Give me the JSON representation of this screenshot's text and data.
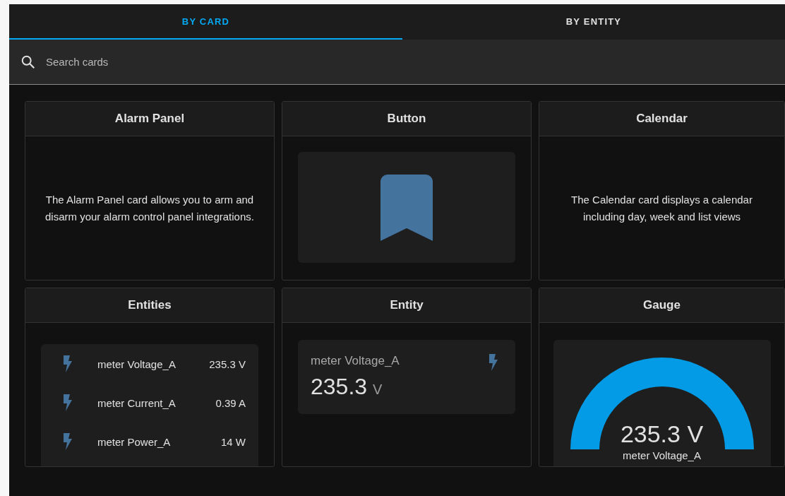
{
  "tabs": [
    {
      "label": "BY CARD",
      "selected": true
    },
    {
      "label": "BY ENTITY",
      "selected": false
    }
  ],
  "search": {
    "placeholder": "Search cards"
  },
  "cards": [
    {
      "title": "Alarm Panel",
      "kind": "text",
      "description": "The Alarm Panel card allows you to arm and disarm your alarm control panel integrations."
    },
    {
      "title": "Button",
      "kind": "button"
    },
    {
      "title": "Calendar",
      "kind": "text",
      "description": "The Calendar card displays a calendar including day, week and list views"
    },
    {
      "title": "Entities",
      "kind": "entities",
      "rows": [
        {
          "name": "meter Voltage_A",
          "state": "235.3 V"
        },
        {
          "name": "meter Current_A",
          "state": "0.39 A"
        },
        {
          "name": "meter Power_A",
          "state": "14 W"
        }
      ]
    },
    {
      "title": "Entity",
      "kind": "entity",
      "name": "meter Voltage_A",
      "value": "235.3",
      "unit": "V"
    },
    {
      "title": "Gauge",
      "kind": "gauge",
      "value": "235.3 V",
      "name": "meter Voltage_A",
      "level": 1
    }
  ]
}
